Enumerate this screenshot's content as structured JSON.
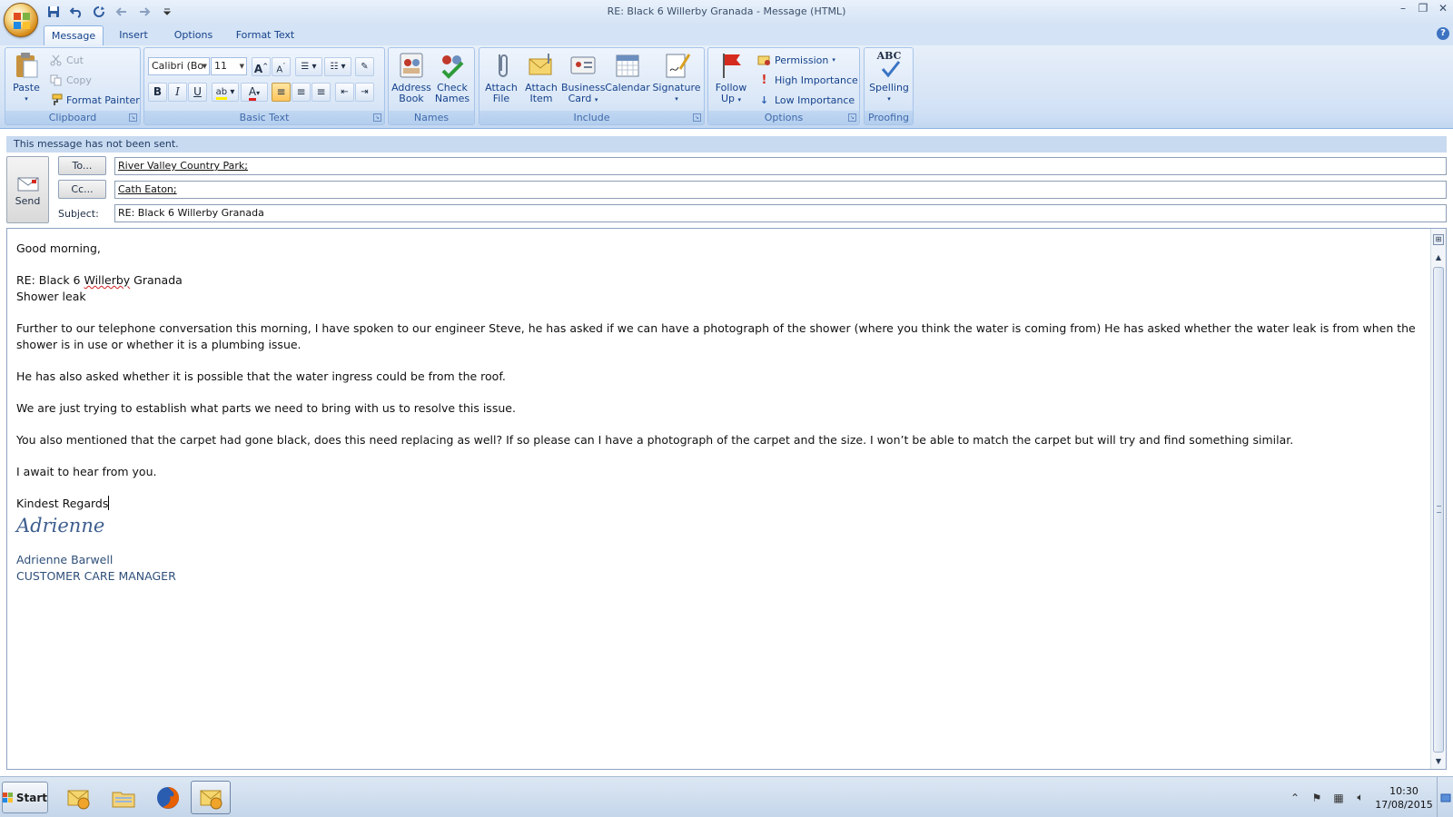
{
  "window": {
    "title": "RE: Black 6 Willerby Granada  - Message (HTML)"
  },
  "tabs": [
    "Message",
    "Insert",
    "Options",
    "Format Text"
  ],
  "ribbon": {
    "clipboard": {
      "label": "Clipboard",
      "paste": "Paste",
      "cut": "Cut",
      "copy": "Copy",
      "format_painter": "Format Painter"
    },
    "basic_text": {
      "label": "Basic Text",
      "font": "Calibri (Bo",
      "size": "11"
    },
    "names": {
      "label": "Names",
      "address_book": [
        "Address",
        "Book"
      ],
      "check_names": [
        "Check",
        "Names"
      ]
    },
    "include": {
      "label": "Include",
      "attach_file": [
        "Attach",
        "File"
      ],
      "attach_item": [
        "Attach",
        "Item"
      ],
      "business_card": [
        "Business",
        "Card"
      ],
      "calendar": "Calendar",
      "signature": "Signature"
    },
    "options": {
      "label": "Options",
      "follow_up": [
        "Follow",
        "Up"
      ],
      "permission": "Permission",
      "high_importance": "High Importance",
      "low_importance": "Low Importance"
    },
    "proofing": {
      "label": "Proofing",
      "spelling": "Spelling",
      "abc": "ABC"
    }
  },
  "info_bar": "This message has not been sent.",
  "header": {
    "send": "Send",
    "to_button": "To...",
    "cc_button": "Cc...",
    "subject_label": "Subject:",
    "to_value": "River Valley Country Park;",
    "cc_value": "Cath Eaton;",
    "subject_value": "RE: Black 6 Willerby Granada"
  },
  "message": {
    "greeting": "Good morning,",
    "re_prefix": "RE: Black 6 ",
    "re_misspelled": "Willerby",
    "re_suffix": " Granada",
    "re_line2": "Shower leak",
    "para1": "Further to our telephone conversation this morning, I have spoken to our engineer Steve, he has asked if we can have a photograph of the shower (where you think the water is coming from)  He has asked whether the water leak is from when the shower is in use or whether it is a plumbing issue.",
    "para2": "He has also asked whether it is possible that the water ingress could be from the roof.",
    "para3": "We are just trying to establish what parts we need to bring with us to resolve this issue.",
    "para4": "You also mentioned that the carpet had gone black, does this need replacing as well?  If so please can I have a photograph of the carpet and the size.  I won’t be able to match the carpet but will try and find something similar.",
    "para5": "I await to hear from you.",
    "closing": "Kindest Regards",
    "signature_script": "Adrienne",
    "signature_name": "Adrienne Barwell",
    "signature_title": "CUSTOMER CARE MANAGER"
  },
  "taskbar": {
    "start": "Start",
    "time": "10:30",
    "date": "17/08/2015"
  },
  "colors": {
    "ribbon_text": "#15428b",
    "info_bar_bg": "#c8daf0",
    "signature": "#3d5e8e"
  }
}
